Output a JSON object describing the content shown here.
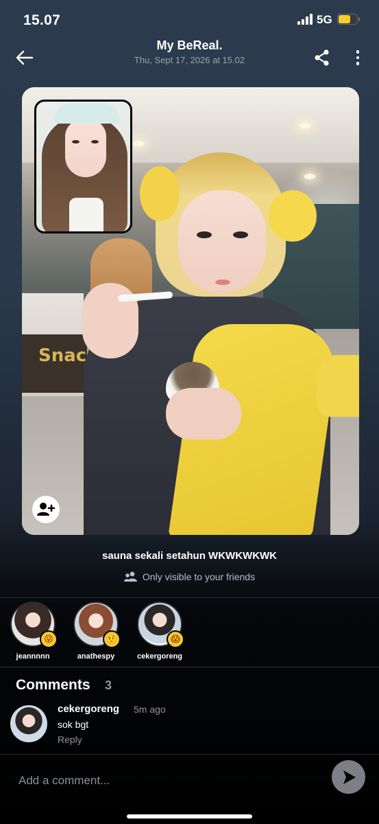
{
  "status_bar": {
    "time": "15.07",
    "network": "5G",
    "battery_level": 0.6,
    "battery_color": "#f4cf2e"
  },
  "header": {
    "title": "My BeReal.",
    "subtitle": "Thu, Sept 17, 2026 at 15.02",
    "back_icon": "arrow-left-icon",
    "share_icon": "share-icon",
    "more_icon": "more-vertical-icon"
  },
  "post": {
    "caption": "sauna sekali setahun WKWKWKWK",
    "visibility": "Only visible to your friends",
    "visibility_icon": "friends-icon",
    "add_friend_icon": "add-user-icon",
    "sign_text": "Snac"
  },
  "reactions": [
    {
      "name": "jeannnnn",
      "emoji": "😝"
    },
    {
      "name": "anathespy",
      "emoji": "🤨"
    },
    {
      "name": "cekergoreng",
      "emoji": "😱"
    }
  ],
  "comments": {
    "title": "Comments",
    "count": "3",
    "items": [
      {
        "user": "cekergoreng",
        "time": "5m ago",
        "text": "sok bgt",
        "reply_label": "Reply"
      }
    ]
  },
  "composer": {
    "placeholder": "Add a comment...",
    "send_icon": "send-icon",
    "send_color": "#7d7f84"
  }
}
